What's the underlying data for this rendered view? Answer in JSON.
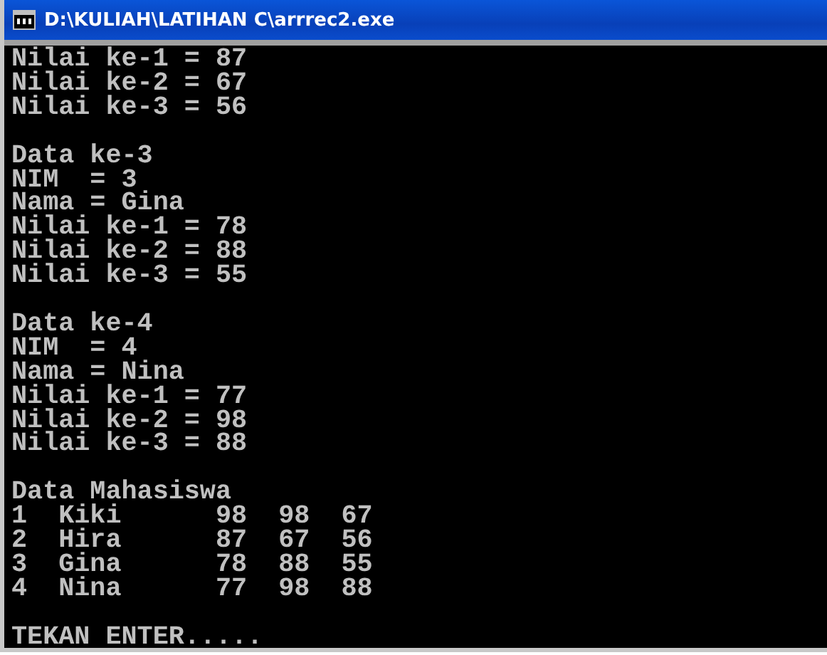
{
  "window": {
    "title": "D:\\KULIAH\\LATIHAN C\\arrrec2.exe"
  },
  "console": {
    "blocks": [
      [
        "Nilai ke-1 = 87",
        "Nilai ke-2 = 67",
        "Nilai ke-3 = 56"
      ],
      [
        "Data ke-3",
        "NIM  = 3",
        "Nama = Gina",
        "Nilai ke-1 = 78",
        "Nilai ke-2 = 88",
        "Nilai ke-3 = 55"
      ],
      [
        "Data ke-4",
        "NIM  = 4",
        "Nama = Nina",
        "Nilai ke-1 = 77",
        "Nilai ke-2 = 98",
        "Nilai ke-3 = 88"
      ],
      [
        "Data Mahasiswa",
        "1  Kiki      98  98  67",
        "2  Hira      87  67  56",
        "3  Gina      78  88  55",
        "4  Nina      77  98  88"
      ],
      [
        "TEKAN ENTER....."
      ]
    ]
  }
}
